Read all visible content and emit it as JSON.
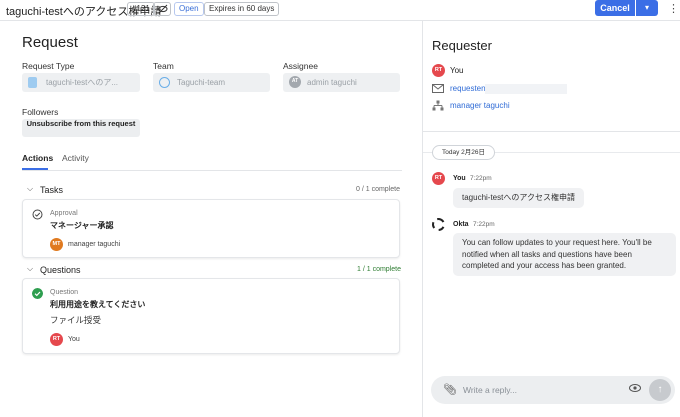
{
  "header": {
    "title": "taguchi-testへのアクセス権申請",
    "id_badge": "#121",
    "status_badge": "Open",
    "expires_badge": "Expires in 60 days",
    "cancel_label": "Cancel"
  },
  "request": {
    "heading": "Request",
    "type_label": "Request Type",
    "type_value": "taguchi-testへのア...",
    "team_label": "Team",
    "team_value": "Taguchi-team",
    "assignee_label": "Assignee",
    "assignee_initials": "AT",
    "assignee_value": "admin taguchi",
    "followers_label": "Followers",
    "unsubscribe_label": "Unsubscribe from this request"
  },
  "tabs": [
    {
      "label": "Actions"
    },
    {
      "label": "Activity"
    }
  ],
  "tasks": {
    "label": "Tasks",
    "progress": "0 / 1 complete",
    "card": {
      "kind": "Approval",
      "name": "マネージャー承認",
      "assignee_initials": "MT",
      "assignee_name": "manager taguchi"
    }
  },
  "questions": {
    "label": "Questions",
    "progress": "1 / 1 complete",
    "card": {
      "kind": "Question",
      "name": "利用用途を教えてください",
      "answer": "ファイル授受",
      "author_initials": "RT",
      "author_name": "You"
    }
  },
  "requester": {
    "heading": "Requester",
    "initials": "RT",
    "name": "You",
    "email": "requesten",
    "manager": "manager taguchi"
  },
  "chat": {
    "date": "Today 2月26日",
    "messages": [
      {
        "initials": "RT",
        "author": "You",
        "time": "7:22pm",
        "text": "taguchi-testへのアクセス権申請"
      },
      {
        "author": "Okta",
        "time": "7:22pm",
        "lines": [
          "You can follow updates to your request here. You'll be",
          "notified when all tasks and questions have been",
          "completed and your access has been granted."
        ]
      }
    ],
    "reply_placeholder": "Write a reply..."
  },
  "colors": {
    "accent": "#3b6ee6",
    "red_avatar": "#e5484d",
    "orange_avatar": "#e07a1f",
    "success": "#2e7d32"
  }
}
